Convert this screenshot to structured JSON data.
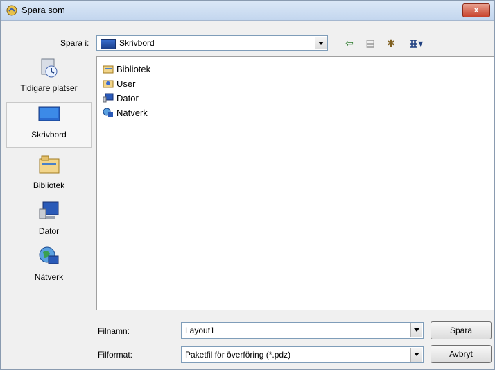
{
  "window": {
    "title": "Spara som",
    "close_label": "x"
  },
  "save_in": {
    "label": "Spara i:",
    "value": "Skrivbord"
  },
  "places": [
    {
      "label": "Tidigare platser",
      "icon": "recent-places-icon"
    },
    {
      "label": "Skrivbord",
      "icon": "desktop-icon"
    },
    {
      "label": "Bibliotek",
      "icon": "libraries-icon"
    },
    {
      "label": "Dator",
      "icon": "computer-icon"
    },
    {
      "label": "Nätverk",
      "icon": "network-icon"
    }
  ],
  "files": [
    {
      "label": "Bibliotek",
      "icon": "libraries-icon"
    },
    {
      "label": "User",
      "icon": "user-folder-icon"
    },
    {
      "label": "Dator",
      "icon": "computer-icon"
    },
    {
      "label": "Nätverk",
      "icon": "network-icon"
    }
  ],
  "filename": {
    "label": "Filnamn:",
    "value": "Layout1"
  },
  "filetype": {
    "label": "Filformat:",
    "value": "Paketfil för överföring (*.pdz)"
  },
  "buttons": {
    "save": "Spara",
    "cancel": "Avbryt"
  }
}
